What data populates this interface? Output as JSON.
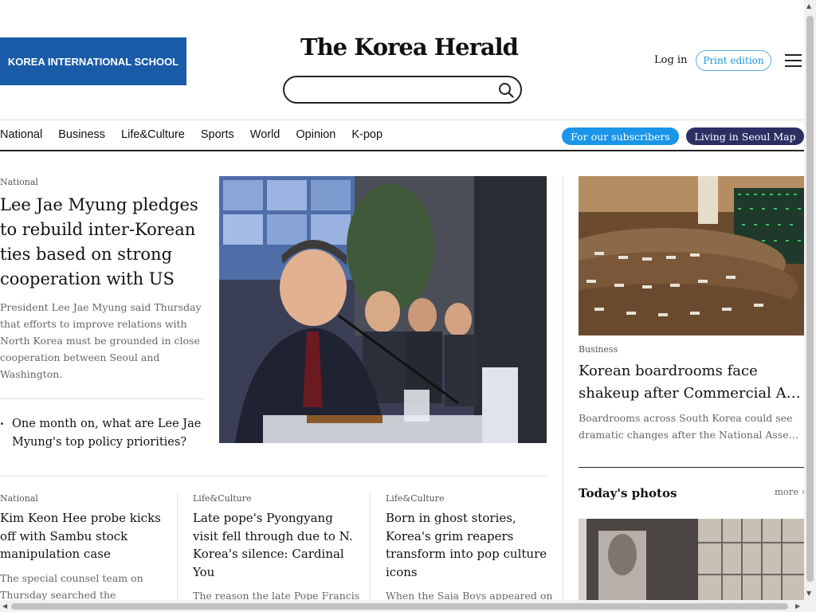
{
  "ad": {
    "label": "KOREA INTERNATIONAL SCHOOL"
  },
  "header": {
    "logo_text": "The Korea Herald",
    "login_label": "Log in",
    "print_label": "Print edition"
  },
  "nav": {
    "items": [
      "National",
      "Business",
      "Life&Culture",
      "Sports",
      "World",
      "Opinion",
      "K-pop"
    ],
    "subscribers_label": "For our subscribers",
    "map_label": "Living in Seoul Map"
  },
  "lead": {
    "section": "National",
    "title": "Lee Jae Myung pledges to rebuild inter-Korean ties based on strong cooperation with US",
    "summary": "President Lee Jae Myung said Thursday that efforts to improve relations with North Korea must be grounded in close cooperation between Seoul and Washington.",
    "related": "One month on, what are Lee Jae Myung's top policy priorities?"
  },
  "right": {
    "section": "Business",
    "title_line1": "Korean boardrooms face",
    "title_line2": "shakeup after Commercial Act revision",
    "summary_line1": "Boardrooms across South Korea could see",
    "summary_line2": "dramatic changes after the National Assembly passed",
    "photos_title": "Today's photos",
    "more_label": "more"
  },
  "cards": [
    {
      "section": "National",
      "title": "Kim Keon Hee probe kicks off with Sambu stock manipulation case",
      "summary": "The special counsel team on Thursday searched the"
    },
    {
      "section": "Life&Culture",
      "title": "Late pope's Pyongyang visit fell through due to N. Korea's silence: Cardinal You",
      "summary": "The reason the late Pope Francis"
    },
    {
      "section": "Life&Culture",
      "title": "Born in ghost stories, Korea's grim reapers transform into pop culture icons",
      "summary": "When the Saja Boys appeared on"
    }
  ]
}
